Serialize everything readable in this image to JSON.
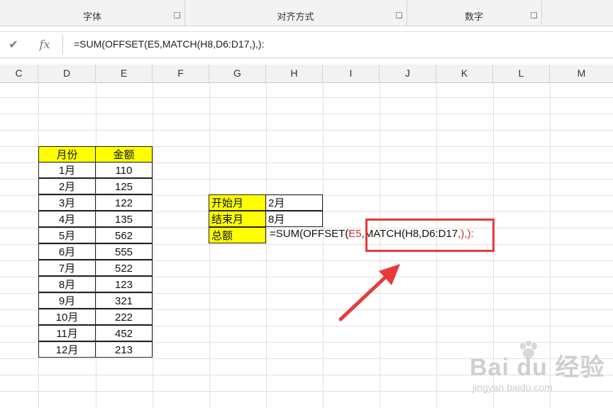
{
  "ribbon": {
    "groups": [
      {
        "label": "字体"
      },
      {
        "label": "对齐方式"
      },
      {
        "label": "数字"
      }
    ]
  },
  "formula_bar": {
    "cancel_icon": "check-icon",
    "fx_label": "fx",
    "content": "=SUM(OFFSET(E5,MATCH(H8,D6:D17,),):"
  },
  "columns": [
    "C",
    "D",
    "E",
    "F",
    "G",
    "H",
    "I",
    "J",
    "K",
    "L",
    "M"
  ],
  "table": {
    "headers": [
      "月份",
      "金额"
    ],
    "rows": [
      [
        "1月",
        "110"
      ],
      [
        "2月",
        "125"
      ],
      [
        "3月",
        "122"
      ],
      [
        "4月",
        "135"
      ],
      [
        "5月",
        "562"
      ],
      [
        "6月",
        "555"
      ],
      [
        "7月",
        "522"
      ],
      [
        "8月",
        "123"
      ],
      [
        "9月",
        "321"
      ],
      [
        "10月",
        "222"
      ],
      [
        "11月",
        "452"
      ],
      [
        "12月",
        "213"
      ]
    ]
  },
  "summary": {
    "start_label": "开始月",
    "start_value": "2月",
    "end_label": "结束月",
    "end_value": "8月",
    "total_label": "总额",
    "formula_prefix": "=SUM(OFFSET(",
    "formula_ref1": "E5",
    "formula_sep": ",",
    "formula_match": "MATCH(",
    "formula_args": "H8,D6:D17",
    "formula_tail": ",),):"
  },
  "colors": {
    "highlight": "#ffff00",
    "annotation": "#e83a3a"
  },
  "watermark": {
    "main": "Bai du 经验",
    "sub": "jingyan.baidu.com"
  }
}
